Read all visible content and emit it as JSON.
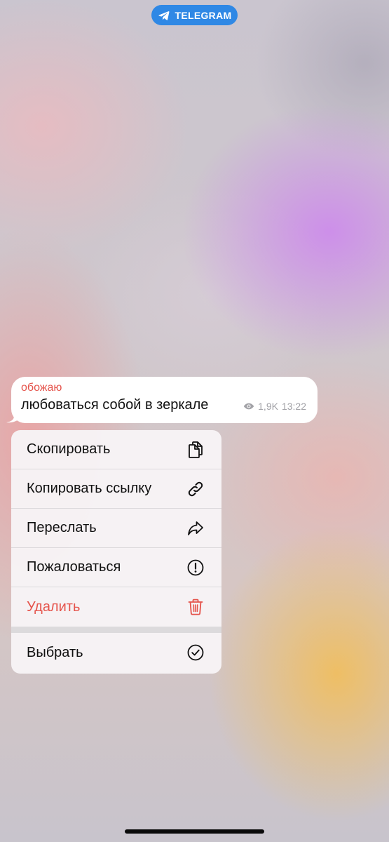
{
  "app_badge": {
    "label": "TELEGRAM",
    "icon": "telegram-plane-icon",
    "color": "#2f88e5"
  },
  "message": {
    "author": "обожаю",
    "text": "любоваться собой в зеркале",
    "views": "1,9K",
    "time": "13:22",
    "author_color": "#e5534b"
  },
  "context_menu": {
    "items": [
      {
        "label": "Скопировать",
        "icon": "copy-icon"
      },
      {
        "label": "Копировать ссылку",
        "icon": "link-icon"
      },
      {
        "label": "Переслать",
        "icon": "forward-icon"
      },
      {
        "label": "Пожаловаться",
        "icon": "report-icon"
      },
      {
        "label": "Удалить",
        "icon": "trash-icon",
        "destructive": true,
        "color": "#e5534b"
      }
    ],
    "select_item": {
      "label": "Выбрать",
      "icon": "checkmark-circle-icon"
    }
  }
}
